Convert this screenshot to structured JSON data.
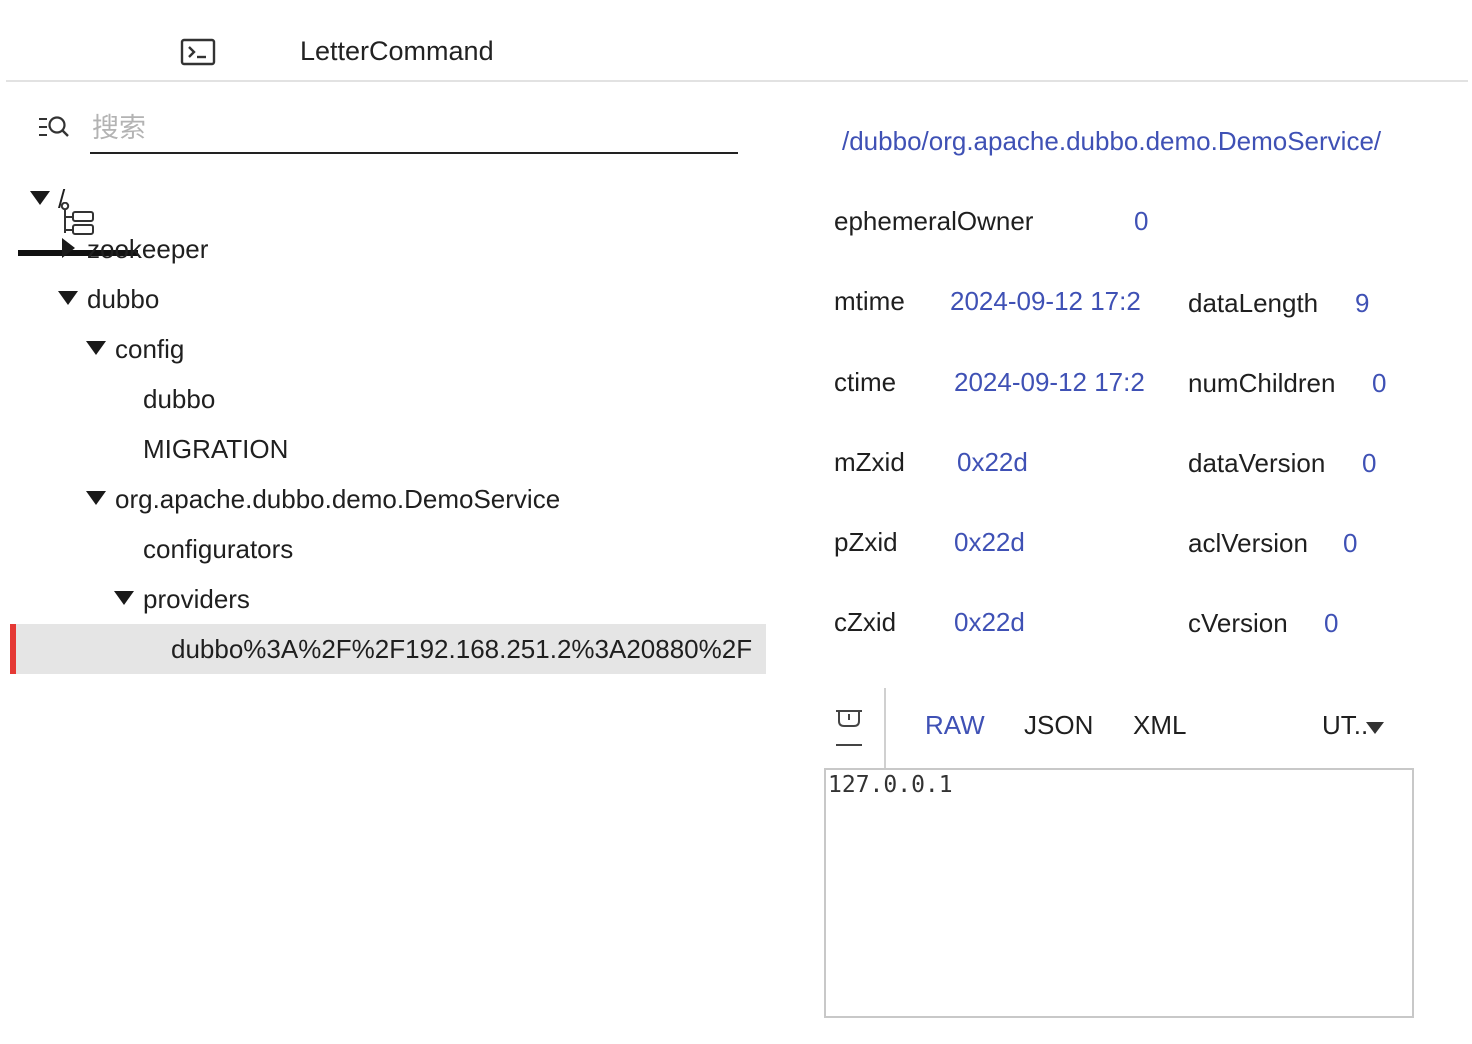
{
  "tabs": {
    "tree_icon": "tree-icon",
    "terminal_icon": "terminal-icon",
    "letter_label": "LetterCommand"
  },
  "search": {
    "placeholder": "搜索",
    "value": ""
  },
  "tree": {
    "root": "/",
    "zookeeper": "zookeeper",
    "dubbo": "dubbo",
    "config": "config",
    "config_dubbo": "dubbo",
    "migration": "MIGRATION",
    "demo_service": "org.apache.dubbo.demo.DemoService",
    "configurators": "configurators",
    "providers": "providers",
    "provider_node": "dubbo%3A%2F%2F192.168.251.2%3A20880%2F"
  },
  "detail": {
    "path": "/dubbo/org.apache.dubbo.demo.DemoService/",
    "stats": {
      "ephemeralOwner_label": "ephemeralOwner",
      "ephemeralOwner": "0",
      "mtime_label": "mtime",
      "mtime": "2024-09-12 17:2",
      "ctime_label": "ctime",
      "ctime": "2024-09-12 17:2",
      "mZxid_label": "mZxid",
      "mZxid": "0x22d",
      "pZxid_label": "pZxid",
      "pZxid": "0x22d",
      "cZxid_label": "cZxid",
      "cZxid": "0x22d",
      "dataLength_label": "dataLength",
      "dataLength": "9",
      "numChildren_label": "numChildren",
      "numChildren": "0",
      "dataVersion_label": "dataVersion",
      "dataVersion": "0",
      "aclVersion_label": "aclVersion",
      "aclVersion": "0",
      "cVersion_label": "cVersion",
      "cVersion": "0"
    }
  },
  "data_panel": {
    "save_icon": "save-icon",
    "formats": [
      "RAW",
      "JSON",
      "XML"
    ],
    "active_format": "RAW",
    "encoding": "UT..",
    "content": "127.0.0.1"
  },
  "colors": {
    "accent": "#3f51b5",
    "selection_bar": "#e53935",
    "selection_bg": "#e5e5e5"
  }
}
